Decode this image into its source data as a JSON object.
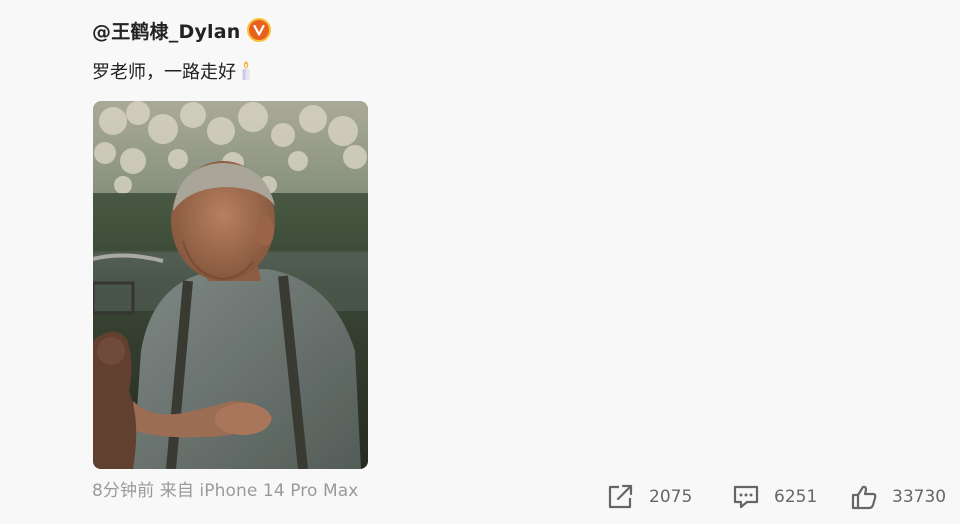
{
  "post": {
    "username": "@王鹤棣_Dylan",
    "verified_badge": "verified-v-icon",
    "content_text": "罗老师，一路走好",
    "content_emoji": "candle-emoji",
    "photo_alt": "elderly man carving by the water",
    "meta_text": "8分钟前 来自 iPhone 14 Pro Max"
  },
  "actions": {
    "repost_count": "2075",
    "comment_count": "6251",
    "like_count": "33730"
  },
  "colors": {
    "background": "#f8f8f8",
    "badge_orange": "#e8611f",
    "badge_ring": "#f7c23a",
    "meta_gray": "#9a9a9a",
    "action_gray": "#666666"
  }
}
